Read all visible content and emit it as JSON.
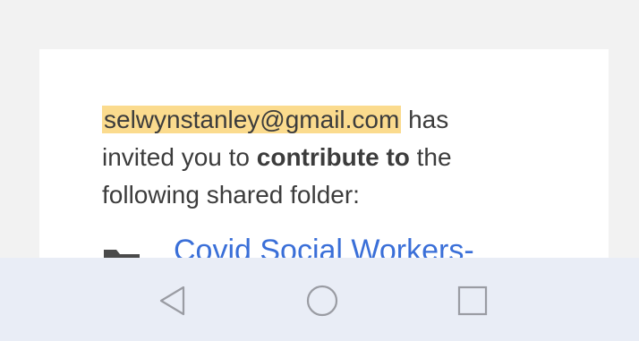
{
  "message": {
    "sender_email": "selwynstanley@gmail.com",
    "text_after_email": " has",
    "line2_prefix": "invited you to ",
    "line2_bold": "contribute to",
    "line2_suffix": " the",
    "line3": "following shared folder:"
  },
  "folder": {
    "icon": "folder-icon",
    "name": "Covid Social Workers-"
  },
  "navigation_bar": {
    "back_icon": "triangle-back-icon",
    "home_icon": "circle-home-icon",
    "recents_icon": "square-recents-icon"
  },
  "colors": {
    "email_highlight": "#fbdb8e",
    "link": "#3a6fd8",
    "nav_background": "#e9edf6"
  }
}
